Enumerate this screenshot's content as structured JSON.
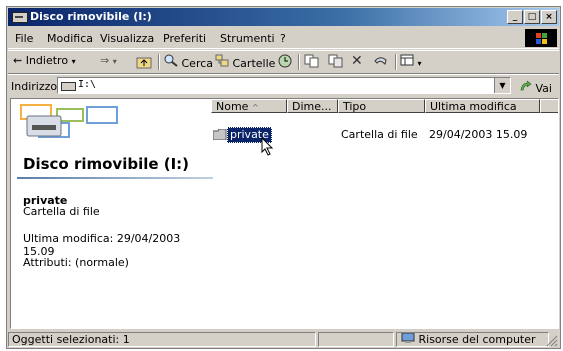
{
  "window": {
    "title": "Disco rimovibile (I:)"
  },
  "title_buttons": [
    "_",
    "□",
    "×"
  ],
  "menu": {
    "items": [
      "File",
      "Modifica",
      "Visualizza",
      "Preferiti",
      "Strumenti",
      "?"
    ]
  },
  "toolbar": {
    "back_label": "Indietro",
    "search_label": "Cerca",
    "folders_label": "Cartelle"
  },
  "address": {
    "label": "Indirizzo",
    "value": "I:\\",
    "go_label": "Vai"
  },
  "left_pane": {
    "folder_title": "Disco rimovibile (I:)",
    "selected_name": "private",
    "selected_type": "Cartella di file",
    "modified_text": "Ultima modifica: 29/04/2003 15.09",
    "attributes_text": "Attributi: (normale)"
  },
  "columns": {
    "name": "Nome",
    "size": "Dime...",
    "type": "Tipo",
    "modified": "Ultima modifica"
  },
  "files": [
    {
      "name": "private",
      "size": "",
      "type": "Cartella di file",
      "modified": "29/04/2003 15.09",
      "selected": true
    }
  ],
  "status": {
    "left": "Oggetti selezionati: 1",
    "right": "Risorse del computer"
  },
  "colors": {
    "title_start": "#0a246a",
    "title_end": "#a6caf0",
    "selection": "#0a246a",
    "face": "#d4d0c8"
  },
  "icons": [
    "drive-icon",
    "back-arrow-icon",
    "forward-arrow-icon",
    "up-folder-icon",
    "search-icon",
    "folders-icon",
    "history-icon",
    "move-to-icon",
    "copy-to-icon",
    "delete-icon",
    "undo-icon",
    "views-icon",
    "folder-icon",
    "computer-icon",
    "pointer-cursor-icon"
  ]
}
